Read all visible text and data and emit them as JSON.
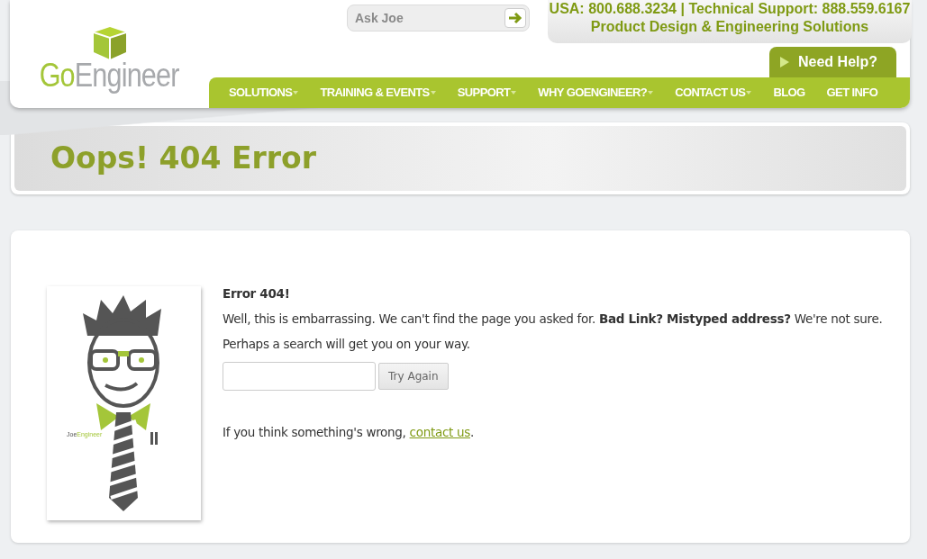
{
  "header": {
    "logo": [
      "Go",
      "Engineer"
    ],
    "search": {
      "placeholder": "Ask Joe"
    },
    "contact_line": "USA: 800.688.3234 | Technical Support: 888.559.6167",
    "tagline": "Product Design & Engineering Solutions",
    "help_tab": "Need Help?"
  },
  "nav": [
    {
      "label": "SOLUTIONS",
      "has_dropdown": true
    },
    {
      "label": "TRAINING & EVENTS",
      "has_dropdown": true
    },
    {
      "label": "SUPPORT",
      "has_dropdown": true
    },
    {
      "label": "WHY GOENGINEER?",
      "has_dropdown": true
    },
    {
      "label": "CONTACT US",
      "has_dropdown": true
    },
    {
      "label": "BLOG",
      "has_dropdown": false
    },
    {
      "label": "GET INFO",
      "has_dropdown": false
    }
  ],
  "page_title": "Oops! 404 Error",
  "content": {
    "illustration_label": [
      "Joe",
      "Engineer"
    ],
    "heading": "Error 404!",
    "message": "Well, this is embarrassing. We can't find the page you asked for. **Bad Link? Mistyped address?** We're not sure.",
    "hint": "Perhaps a search will get you on your way.",
    "search_button": "Try Again",
    "footer_text": "If you think something's wrong,",
    "footer_link": "contact us",
    "footer_end": "."
  }
}
